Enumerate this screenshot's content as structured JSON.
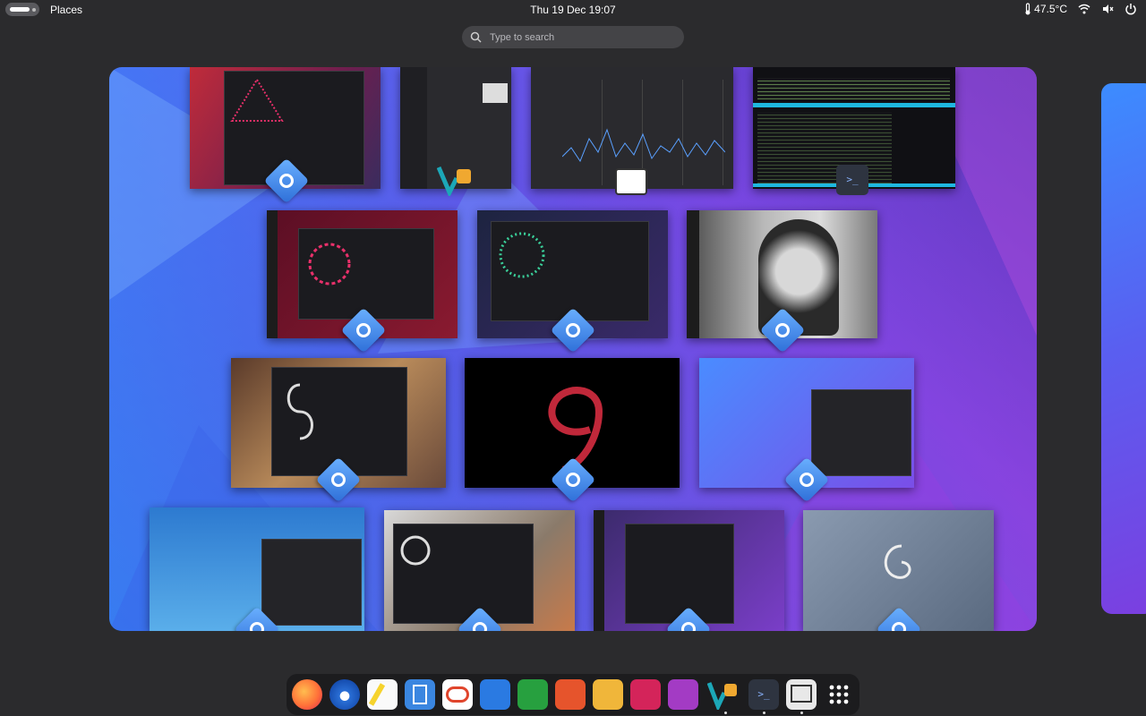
{
  "topbar": {
    "activities_label": "",
    "places_label": "Places",
    "clock": "Thu 19 Dec  19:07",
    "temperature": "47.5°C",
    "icons": [
      "thermometer-icon",
      "wifi-icon",
      "volume-muted-icon",
      "power-icon"
    ]
  },
  "search": {
    "placeholder": "Type to search"
  },
  "overview": {
    "window_count": 17,
    "app_icon": "settings-applet-icon"
  },
  "dock": {
    "items": [
      {
        "name": "firefox",
        "color": "#ff7139"
      },
      {
        "name": "thunderbird",
        "color": "#2a6fd6"
      },
      {
        "name": "text-editor",
        "color": "#f6d32d"
      },
      {
        "name": "document-viewer",
        "color": "#3a86e0"
      },
      {
        "name": "dconf-editor",
        "color": "#e0452c"
      },
      {
        "name": "writer",
        "color": "#2a7ae2"
      },
      {
        "name": "calc",
        "color": "#27a03f"
      },
      {
        "name": "impress",
        "color": "#e6542c"
      },
      {
        "name": "draw",
        "color": "#f0b63a"
      },
      {
        "name": "math",
        "color": "#d4245a"
      },
      {
        "name": "base",
        "color": "#a33bc4"
      },
      {
        "name": "vscodium",
        "color": "#1ca7b8"
      },
      {
        "name": "terminal",
        "color": "#2e3440"
      },
      {
        "name": "system-monitor",
        "color": "#e8e8e8"
      },
      {
        "name": "show-apps",
        "color": "#ffffff"
      }
    ],
    "running": [
      11,
      12,
      13
    ]
  },
  "colors": {
    "accent": "#3584e4",
    "panel": "#2b2b2d",
    "dock": "#1c1c1e"
  }
}
